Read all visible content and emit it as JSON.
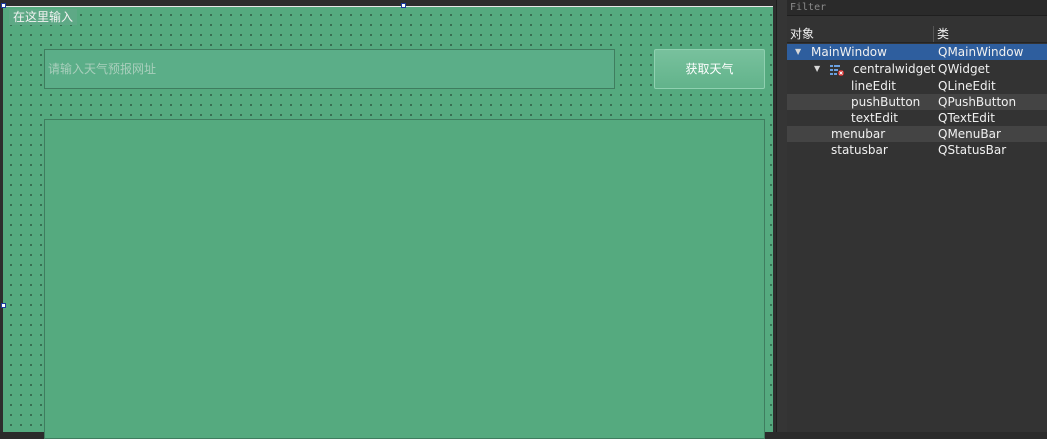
{
  "form": {
    "menubar_placeholder": "在这里输入",
    "line_edit_placeholder": "请输入天气预报网址",
    "push_button_label": "获取天气",
    "colors": {
      "background": "#55aa7f",
      "button": "#6ab893"
    }
  },
  "inspector": {
    "filter_placeholder": "Filter",
    "column_object": "对象",
    "column_class": "类",
    "rows": [
      {
        "object": "MainWindow",
        "class": "QMainWindow",
        "depth": 0,
        "expanded": true,
        "selected": true
      },
      {
        "object": "centralwidget",
        "class": "QWidget",
        "depth": 1,
        "expanded": true,
        "icon": "layout-widget-icon"
      },
      {
        "object": "lineEdit",
        "class": "QLineEdit",
        "depth": 2
      },
      {
        "object": "pushButton",
        "class": "QPushButton",
        "depth": 2
      },
      {
        "object": "textEdit",
        "class": "QTextEdit",
        "depth": 2
      },
      {
        "object": "menubar",
        "class": "QMenuBar",
        "depth": 1
      },
      {
        "object": "statusbar",
        "class": "QStatusBar",
        "depth": 1
      }
    ],
    "colors": {
      "selected_row": "#2e5e9e"
    }
  }
}
